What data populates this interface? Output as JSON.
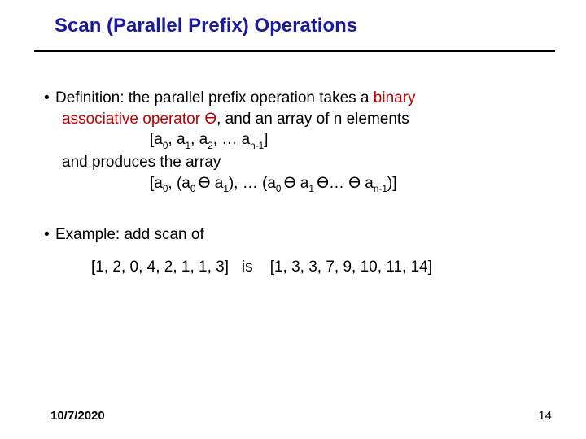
{
  "title": "Scan (Parallel Prefix) Operations",
  "def": {
    "line1a": "Definition: the parallel prefix operation takes a ",
    "binary": "binary",
    "line2a": "associative operator ",
    "op": "ϴ",
    "line2b": ", and an array of n elements",
    "array_in": {
      "open": "[a",
      "s0": "0",
      "c1": ", a",
      "s1": "1",
      "c2": ", a",
      "s2": "2",
      "c3": ", … a",
      "sn1": "n-1",
      "close": "]"
    },
    "line3": "and produces the array",
    "array_out": {
      "open": "[a",
      "s0": "0",
      "p1a": ", (a",
      "p1s0": "0 ",
      "p1op": "ϴ",
      "p1b": " a",
      "p1s1": "1",
      "p1c": "), … (a",
      "p2s0": "0 ",
      "p2op": "ϴ",
      "p2b": "  a",
      "p2s1": "1 ",
      "p3op": "ϴ",
      "dots": "…  ",
      "p4op": "ϴ",
      "p4a": " a",
      "p4s": "n-1",
      "close": ")]"
    }
  },
  "example": {
    "lead": "Example: add scan of",
    "in": "[1, 2, 0, 4, 2, 1, 1, 3]",
    "is": "is",
    "out": "[1, 3, 3, 7, 9, 10, 11, 14]"
  },
  "footer": {
    "date": "10/7/2020",
    "page": "14"
  }
}
